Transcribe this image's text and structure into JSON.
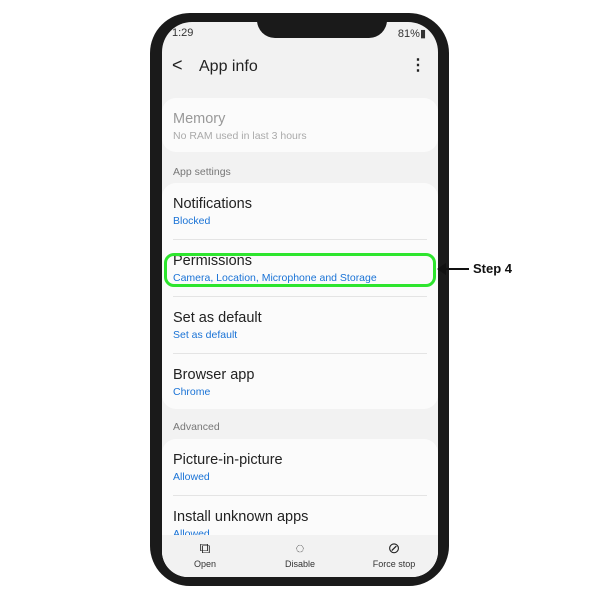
{
  "status": {
    "time": "1:29",
    "battery": "81%"
  },
  "header": {
    "title": "App info",
    "back_icon": "chevron-left-icon",
    "more_icon": "more-vert-icon"
  },
  "memory": {
    "title": "Memory",
    "subtitle": "No RAM used in last 3 hours"
  },
  "sections": {
    "app_settings": "App settings",
    "advanced": "Advanced"
  },
  "items": [
    {
      "title": "Notifications",
      "subtitle": "Blocked"
    },
    {
      "title": "Permissions",
      "subtitle": "Camera, Location, Microphone and Storage"
    },
    {
      "title": "Set as default",
      "subtitle": "Set as default"
    },
    {
      "title": "Browser app",
      "subtitle": "Chrome"
    },
    {
      "title": "Picture-in-picture",
      "subtitle": "Allowed"
    },
    {
      "title": "Install unknown apps",
      "subtitle": "Allowed"
    }
  ],
  "bottom": [
    {
      "label": "Open",
      "icon": "open-external-icon"
    },
    {
      "label": "Disable",
      "icon": "dotted-circle-icon"
    },
    {
      "label": "Force stop",
      "icon": "stop-circle-icon"
    }
  ],
  "annotation": {
    "label": "Step 4",
    "highlight_color": "#2ee52e"
  }
}
